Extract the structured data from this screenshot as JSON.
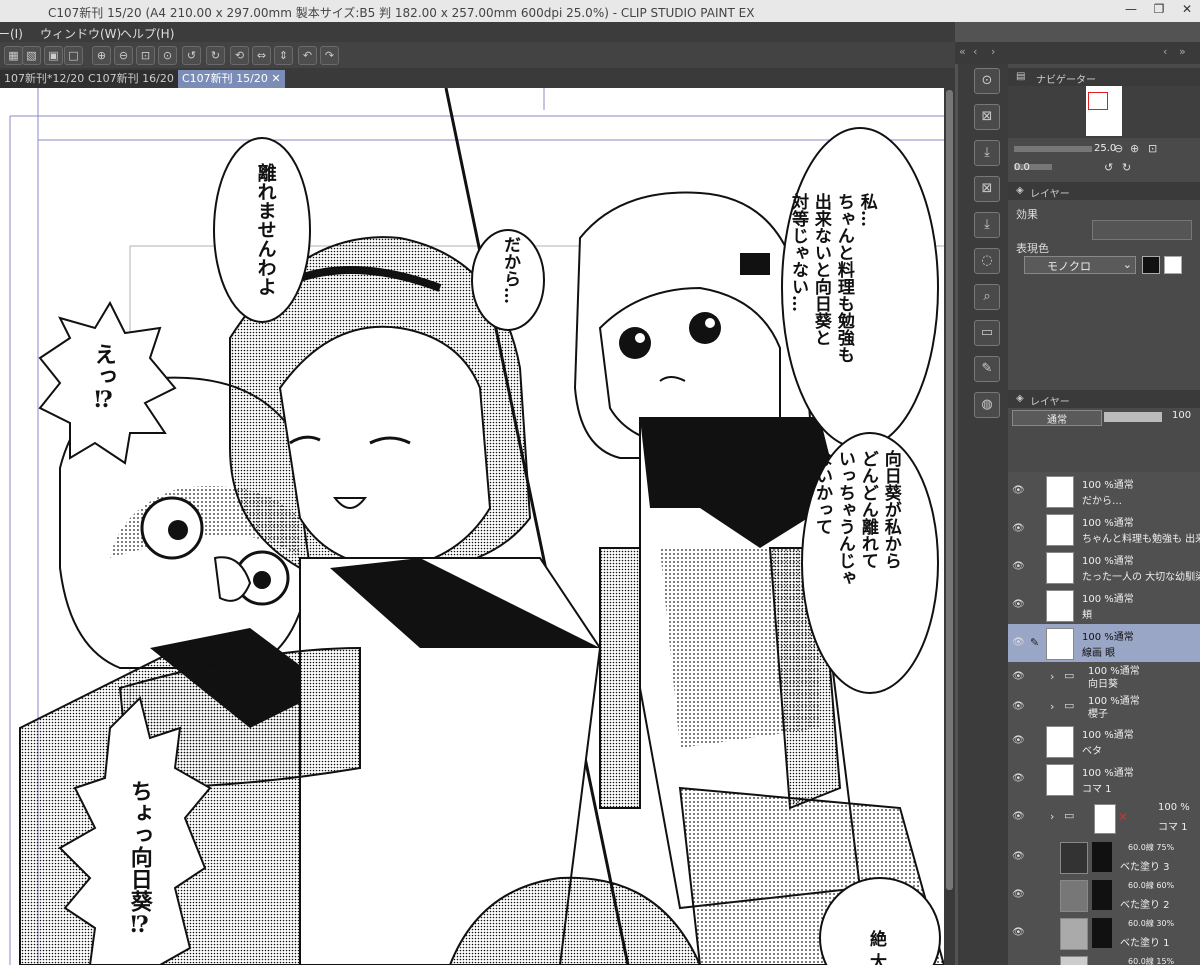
{
  "window": {
    "title": "C107新刊 15/20 (A4 210.00 x 297.00mm 製本サイズ:B5 判 182.00 x 257.00mm 600dpi 25.0%) - CLIP STUDIO PAINT EX",
    "minimize": "—",
    "restore": "❐",
    "close": "✕"
  },
  "menu": [
    "ー(I)",
    "ウィンドウ(W)",
    "ヘルプ(H)"
  ],
  "tabs": [
    "107新刊*12/20 ●",
    "C107新刊 16/20 ✕",
    "C107新刊 15/20 ✕"
  ],
  "speech": {
    "bubble1": "離れませんわよ",
    "bubble2": "だから…",
    "bubble3": "私…\nちゃんと料理も勉強も\n出来ないと向日葵と\n対等じゃない…",
    "bubble4": "向日葵が私から\nどんどん離れて\nいっちゃうんじゃ\nないかって",
    "shout1": "えっ⁉",
    "shout2": "ちょっ向日葵⁉",
    "bottom": "絶 大 た"
  },
  "navigator": {
    "title": "ナビゲーター",
    "zoom": "25.0",
    "rotate": "0.0"
  },
  "layer_property": {
    "tab": "レイヤー",
    "effect_label": "効果",
    "color_label": "表現色",
    "color_value": "モノクロ"
  },
  "layers_panel": {
    "tab": "レイヤー",
    "blend_mode": "通常",
    "opacity": "100"
  },
  "layers": [
    {
      "mode": "100 %通常",
      "name": "だから…"
    },
    {
      "mode": "100 %通常",
      "name": "ちゃんと料理も勉強も 出来な"
    },
    {
      "mode": "100 %通常",
      "name": "たった一人の 大切な幼馴染な"
    },
    {
      "mode": "100 %通常",
      "name": "頬"
    },
    {
      "mode": "100 %通常",
      "name": "線画 眼"
    },
    {
      "mode": "100 %通常",
      "name": "向日葵"
    },
    {
      "mode": "100 %通常",
      "name": "櫻子"
    },
    {
      "mode": "100 %通常",
      "name": "ベタ"
    },
    {
      "mode": "100 %通常",
      "name": "コマ 1"
    },
    {
      "mode": "100 %",
      "name": "コマ 1"
    },
    {
      "mode": "60.0線 75%",
      "name": "ベた塗り 3"
    },
    {
      "mode": "60.0線 60%",
      "name": "ベた塗り 2"
    },
    {
      "mode": "60.0線 30%",
      "name": "ベた塗り 1"
    },
    {
      "mode": "60.0線 15%",
      "name": ""
    }
  ],
  "icons": [
    "zoom-in-icon",
    "zoom-out-icon",
    "fit-icon",
    "rotate-left-icon",
    "rotate-right-icon",
    "reset-icon",
    "flip-icon",
    "undo-icon",
    "redo-icon"
  ],
  "colors": {
    "accent": "#7b8db6",
    "panel": "#4a4a4a",
    "selected_layer": "#9aa6c6"
  }
}
